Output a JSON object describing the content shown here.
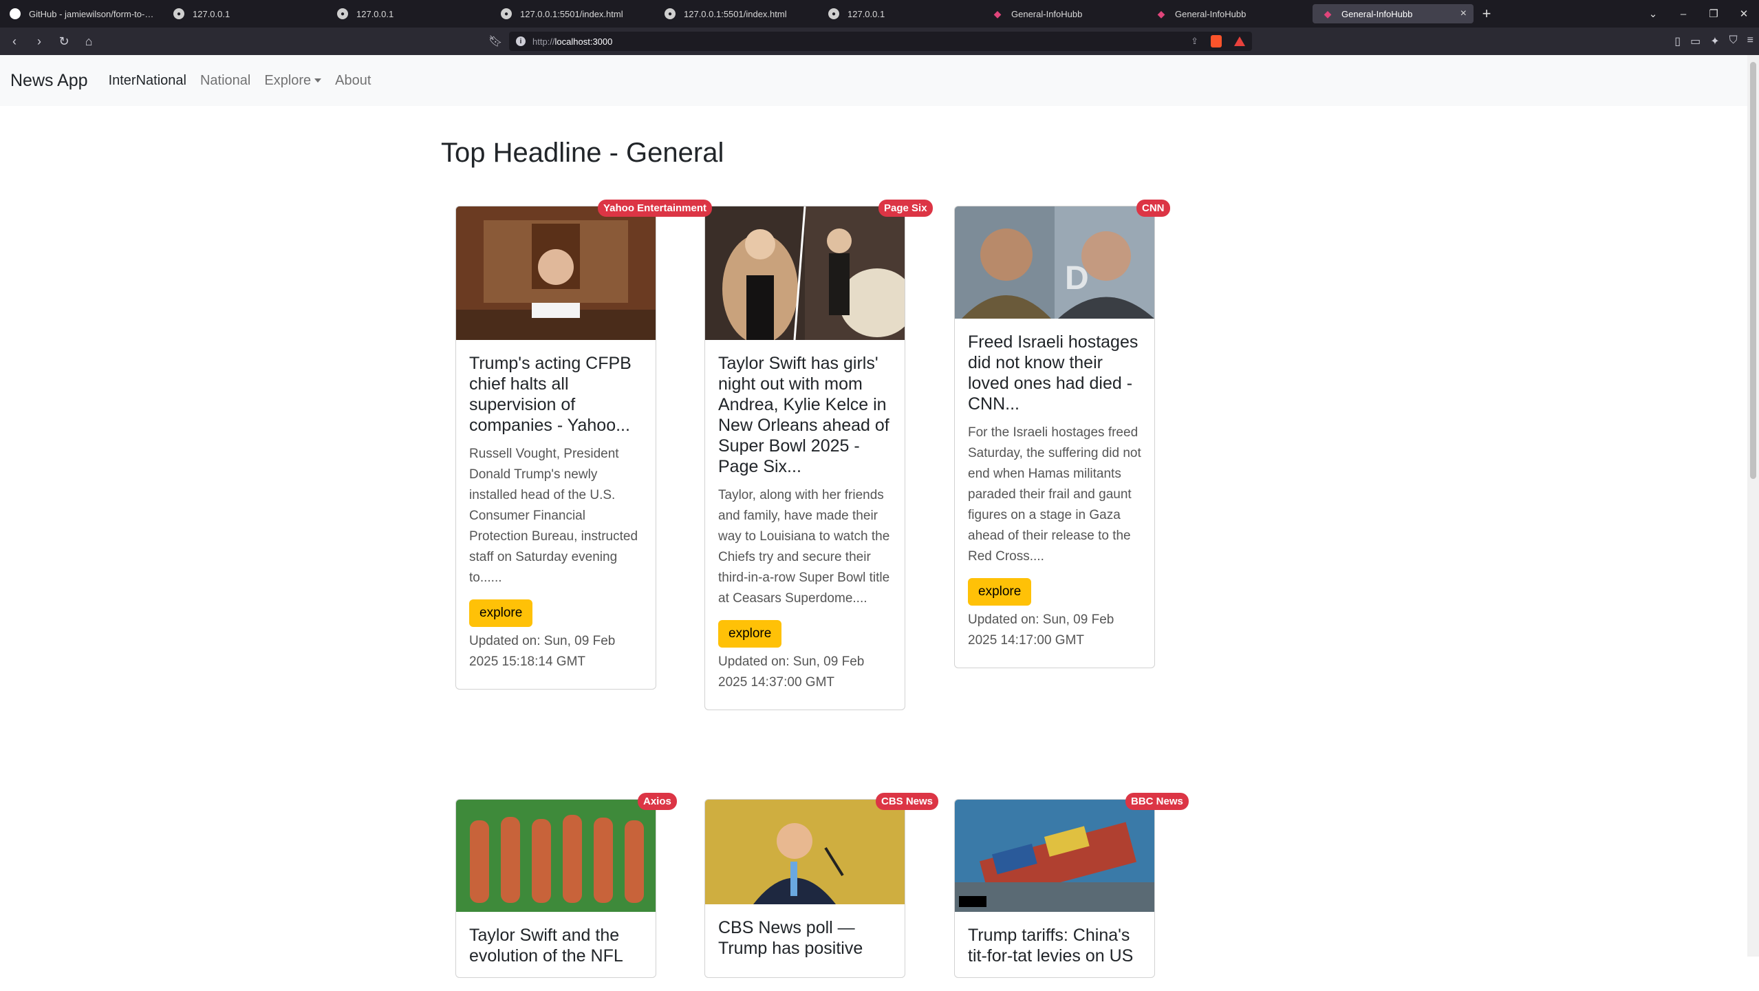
{
  "browser": {
    "tabs": [
      {
        "title": "GitHub - jamiewilson/form-to-goo...",
        "icon": "github-icon"
      },
      {
        "title": "127.0.0.1",
        "icon": "globe-icon"
      },
      {
        "title": "127.0.0.1",
        "icon": "globe-icon"
      },
      {
        "title": "127.0.0.1:5501/index.html",
        "icon": "globe-icon"
      },
      {
        "title": "127.0.0.1:5501/index.html",
        "icon": "globe-icon"
      },
      {
        "title": "127.0.0.1",
        "icon": "globe-icon"
      },
      {
        "title": "General-InfoHubb",
        "icon": "pink-icon"
      },
      {
        "title": "General-InfoHubb",
        "icon": "pink-icon"
      },
      {
        "title": "General-InfoHubb",
        "icon": "pink-icon",
        "active": true
      }
    ],
    "url_prefix": "http://",
    "url_host": "localhost:3000"
  },
  "navbar": {
    "brand": "News App",
    "links": [
      "InterNational",
      "National",
      "Explore",
      "About"
    ]
  },
  "page_title": "Top Headline - General",
  "cards": [
    {
      "source": "Yahoo Entertainment",
      "title": "Trump's acting CFPB chief halts all supervision of companies - Yahoo...",
      "description": "Russell Vought, President Donald Trump's newly installed head of the U.S. Consumer Financial Protection Bureau, instructed staff on Saturday evening to......",
      "button": "explore",
      "updated": "Updated on: Sun, 09 Feb 2025 15:18:14 GMT"
    },
    {
      "source": "Page Six",
      "title": "Taylor Swift has girls' night out with mom Andrea, Kylie Kelce in New Orleans ahead of Super Bowl 2025 - Page Six...",
      "description": "Taylor, along with her friends and family, have made their way to Louisiana to watch the Chiefs try and secure their third-in-a-row Super Bowl title at Ceasars Superdome....",
      "button": "explore",
      "updated": "Updated on: Sun, 09 Feb 2025 14:37:00 GMT"
    },
    {
      "source": "CNN",
      "title": "Freed Israeli hostages did not know their loved ones had died - CNN...",
      "description": "For the Israeli hostages freed Saturday, the suffering did not end when Hamas militants paraded their frail and gaunt figures on a stage in Gaza ahead of their release to the Red Cross....",
      "button": "explore",
      "updated": "Updated on: Sun, 09 Feb 2025 14:17:00 GMT"
    },
    {
      "source": "Axios",
      "title": "Taylor Swift and the evolution of the NFL"
    },
    {
      "source": "CBS News",
      "title": "CBS News poll — Trump has positive"
    },
    {
      "source": "BBC News",
      "title": "Trump tariffs: China's tit-for-tat levies on US"
    }
  ]
}
